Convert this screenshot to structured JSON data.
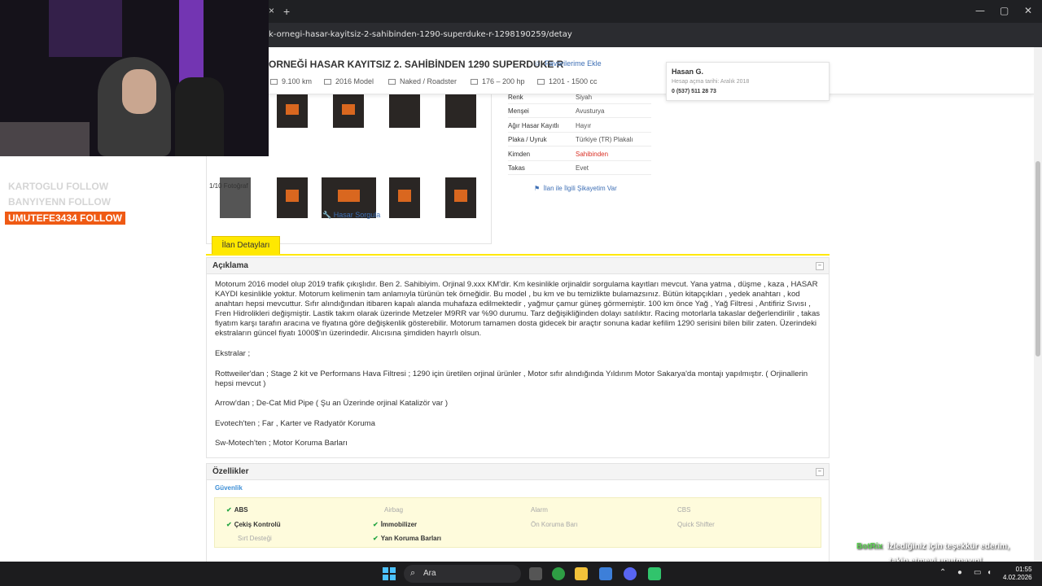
{
  "browser": {
    "url": "k-ornegi-hasar-kayitsiz-2-sahibinden-1290-superduke-r-1298190259/detay",
    "new_tab": "+",
    "close_tab": "×",
    "minimize": "—",
    "maximize": "▢",
    "close": "✕"
  },
  "listing": {
    "title": "ORNEĞİ HASAR KAYITSIZ 2. SAHİBİNDEN 1290 SUPERDUKE R",
    "favorite_label": "Favorilerime Ekle",
    "specs": [
      {
        "icon": "speedometer-icon",
        "value": "9.100 km"
      },
      {
        "icon": "calendar-icon",
        "value": "2016 Model"
      },
      {
        "icon": "motorcycle-icon",
        "value": "Naked / Roadster"
      },
      {
        "icon": "engine-icon",
        "value": "176 – 200 hp"
      },
      {
        "icon": "volume-icon",
        "value": "1201 - 1500 cc"
      }
    ]
  },
  "seller": {
    "name": "Hasan G.",
    "joined": "Hesap açma tarihi: Aralık 2018",
    "phone": "0 (537) 511 28 73"
  },
  "gallery": {
    "photo_count": "1/10 Fotoğraf",
    "damage_query": "Hasar Sorgula"
  },
  "details": [
    {
      "key": "Renk",
      "value": "Siyah"
    },
    {
      "key": "Menşei",
      "value": "Avusturya"
    },
    {
      "key": "Ağır Hasar Kayıtlı",
      "value": "Hayır"
    },
    {
      "key": "Plaka / Uyruk",
      "value": "Türkiye (TR) Plakalı"
    },
    {
      "key": "Kimden",
      "value": "Sahibinden",
      "color": "#d93025"
    },
    {
      "key": "Takas",
      "value": "Evet"
    }
  ],
  "complaint_link": "İlan ile İlgili Şikayetim Var",
  "tab_label": "İlan Detayları",
  "description": {
    "heading": "Açıklama",
    "paragraphs": [
      "Motorum 2016 model olup 2019 trafik çıkışlıdır. Ben 2. Sahibiyim. Orjinal 9.xxx KM'dir. Km kesinlikle orjinaldir sorgulama kayıtları mevcut. Yana yatma , düşme , kaza , HASAR KAYDI kesinlikle yoktur. Motorum kelimenin tam anlamıyla türünün tek örneğidir. Bu model , bu km ve bu temizlikte bulamazsınız. Bütün kitapçıkları , yedek anahtarı , kod anahtarı hepsi mevcuttur. Sıfır alındığından itibaren kapalı alanda muhafaza edilmektedir , yağmur çamur güneş görmemiştir. 100 km önce Yağ , Yağ Filtresi , Antifiriz Sıvısı , Fren Hidrolikleri değişmiştir. Lastik takım olarak üzerinde Metzeler M9RR var %90 durumu. Tarz değişikliğinden dolayı satılıktır. Racing motorlarla takaslar değerlendirilir , takas fiyatım karşı tarafın aracına ve fiyatına göre değişkenlik gösterebilir. Motorum tamamen dosta gidecek bir araçtır sonuna kadar kefilim 1290 serisini bilen bilir zaten. Üzerindeki ekstraların güncel fiyatı 1000$'ın üzerindedir. Alıcısına şimdiden hayırlı olsun.",
      "Ekstralar ;",
      "Rottweiler'dan ; Stage 2 kit ve Performans Hava Filtresi ; 1290 için üretilen orjinal ürünler , Motor sıfır alındığında Yıldırım Motor Sakarya'da montajı yapılmıştır. ( Orjinallerin hepsi mevcut )",
      "Arrow'dan ; De-Cat Mid Pipe ( Şu an Üzerinde orjinal Katalizör var )",
      "Evotech'ten ; Far , Karter ve Radyatör Koruma",
      "Sw-Motech'ten ; Motor Koruma Barları"
    ]
  },
  "features": {
    "heading": "Özellikler",
    "group": "Güvenlik",
    "items": [
      {
        "label": "ABS",
        "on": true
      },
      {
        "label": "Airbag",
        "on": false
      },
      {
        "label": "Alarm",
        "on": false
      },
      {
        "label": "CBS",
        "on": false
      },
      {
        "label": "Çekiş Kontrolü",
        "on": true
      },
      {
        "label": "İmmobilizer",
        "on": true
      },
      {
        "label": "Ön Koruma Barı",
        "on": false
      },
      {
        "label": "Quick Shifter",
        "on": false
      },
      {
        "label": "Sırt Desteği",
        "on": false
      },
      {
        "label": "Yan Koruma Barları",
        "on": true
      }
    ]
  },
  "stream": {
    "follows": [
      "KARTOGLU  FOLLOW",
      "BANYIYENN  FOLLOW",
      "UMUTEFE3434  FOLLOW"
    ],
    "bot_name": "BotRix",
    "bot_line1": "İzlediğiniz için teşekkür ederim,",
    "bot_line2": "takip etmeyi unutmayın!"
  },
  "taskbar": {
    "search_label": "Ara",
    "time": "01:55",
    "date": "4.02.2026"
  },
  "colors": {
    "accent_yellow": "#ffe800",
    "link_blue": "#3e6fb5",
    "follow_orange": "#ef5a14",
    "check_green": "#28a745"
  }
}
